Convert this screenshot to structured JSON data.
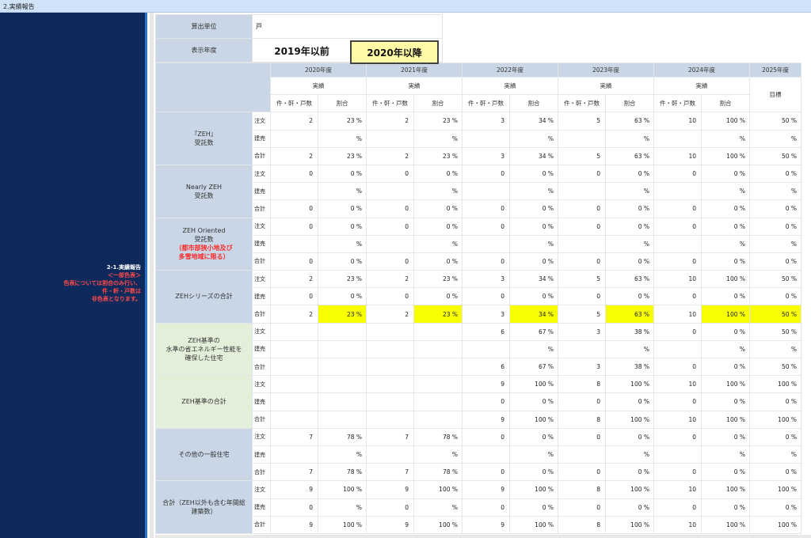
{
  "header": {
    "title": "2.実績報告"
  },
  "sidebar": {
    "title": "2-1.実績報告",
    "note1": "＜一部色表＞",
    "note2": "色表については割合のみ行い、",
    "note3": "件・軒・戸数は",
    "note4": "非色表となります。"
  },
  "settings": {
    "unit_label": "算出単位",
    "unit_value": "戸",
    "year_label": "表示年度",
    "year_before": "2019年以前",
    "year_after": "2020年以降"
  },
  "table": {
    "years": [
      "2020年度",
      "2021年度",
      "2022年度",
      "2023年度",
      "2024年度",
      "2025年度"
    ],
    "jisseki": "実績",
    "count_label": "件・軒・戸数",
    "ratio_label": "割合",
    "target_label": "目標",
    "row_types": [
      "注文",
      "建売",
      "合計"
    ],
    "sections": [
      {
        "name": "『ZEH』\n受託数",
        "rows": [
          [
            "2",
            "23 %",
            "2",
            "23 %",
            "3",
            "34 %",
            "5",
            "63 %",
            "10",
            "100 %",
            "50 %"
          ],
          [
            "",
            "%",
            "",
            "%",
            "",
            "%",
            "",
            "%",
            "",
            "%",
            "%"
          ],
          [
            "2",
            "23 %",
            "2",
            "23 %",
            "3",
            "34 %",
            "5",
            "63 %",
            "10",
            "100 %",
            "50 %"
          ]
        ]
      },
      {
        "name": "Nearly ZEH\n受託数",
        "rows": [
          [
            "0",
            "0 %",
            "0",
            "0 %",
            "0",
            "0 %",
            "0",
            "0 %",
            "0",
            "0 %",
            "0 %"
          ],
          [
            "",
            "%",
            "",
            "%",
            "",
            "%",
            "",
            "%",
            "",
            "%",
            "%"
          ],
          [
            "0",
            "0 %",
            "0",
            "0 %",
            "0",
            "0 %",
            "0",
            "0 %",
            "0",
            "0 %",
            "0 %"
          ]
        ]
      },
      {
        "name": "ZEH Oriented\n受託数",
        "note": "（都市部狭小地及び\n多雪地域に限る）",
        "rows": [
          [
            "0",
            "0 %",
            "0",
            "0 %",
            "0",
            "0 %",
            "0",
            "0 %",
            "0",
            "0 %",
            "0 %"
          ],
          [
            "",
            "%",
            "",
            "%",
            "",
            "%",
            "",
            "%",
            "",
            "%",
            "%"
          ],
          [
            "0",
            "0 %",
            "0",
            "0 %",
            "0",
            "0 %",
            "0",
            "0 %",
            "0",
            "0 %",
            "0 %"
          ]
        ]
      },
      {
        "name": "ZEHシリーズの合計",
        "rows": [
          [
            "2",
            "23 %",
            "2",
            "23 %",
            "3",
            "34 %",
            "5",
            "63 %",
            "10",
            "100 %",
            "50 %"
          ],
          [
            "0",
            "0 %",
            "0",
            "0 %",
            "0",
            "0 %",
            "0",
            "0 %",
            "0",
            "0 %",
            "0 %"
          ],
          [
            "2",
            "23 %",
            "2",
            "23 %",
            "3",
            "34 %",
            "5",
            "63 %",
            "10",
            "100 %",
            "50 %"
          ]
        ]
      },
      {
        "name": "ZEH基準の\n水準の省エネルギー性能を\n確保した住宅",
        "green": true,
        "rows": [
          [
            "",
            "",
            "",
            "",
            "6",
            "67 %",
            "3",
            "38 %",
            "0",
            "0 %",
            "50 %"
          ],
          [
            "",
            "",
            "",
            "",
            "",
            "%",
            "",
            "%",
            "",
            "%",
            "%"
          ],
          [
            "",
            "",
            "",
            "",
            "6",
            "67 %",
            "3",
            "38 %",
            "0",
            "0 %",
            "50 %"
          ]
        ]
      },
      {
        "name": "ZEH基準の合計",
        "green": true,
        "rows": [
          [
            "",
            "",
            "",
            "",
            "9",
            "100 %",
            "8",
            "100 %",
            "10",
            "100 %",
            "100 %"
          ],
          [
            "",
            "",
            "",
            "",
            "0",
            "0 %",
            "0",
            "0 %",
            "0",
            "0 %",
            "0 %"
          ],
          [
            "",
            "",
            "",
            "",
            "9",
            "100 %",
            "8",
            "100 %",
            "10",
            "100 %",
            "100 %"
          ]
        ]
      },
      {
        "name": "その他の一般住宅",
        "rows": [
          [
            "7",
            "78 %",
            "7",
            "78 %",
            "0",
            "0 %",
            "0",
            "0 %",
            "0",
            "0 %",
            "0 %"
          ],
          [
            "",
            "%",
            "",
            "%",
            "",
            "%",
            "",
            "%",
            "",
            "%",
            "%"
          ],
          [
            "7",
            "78 %",
            "7",
            "78 %",
            "0",
            "0 %",
            "0",
            "0 %",
            "0",
            "0 %",
            "0 %"
          ]
        ]
      },
      {
        "name": "合計（ZEH以外も含む年間総\n建築数）",
        "rows": [
          [
            "9",
            "100 %",
            "9",
            "100 %",
            "9",
            "100 %",
            "8",
            "100 %",
            "10",
            "100 %",
            "100 %"
          ],
          [
            "0",
            "%",
            "0",
            "%",
            "0",
            "0 %",
            "0",
            "0 %",
            "0",
            "0 %",
            "0 %"
          ],
          [
            "9",
            "100 %",
            "9",
            "100 %",
            "9",
            "100 %",
            "8",
            "100 %",
            "10",
            "100 %",
            "100 %"
          ]
        ]
      }
    ],
    "highlight_color": "#f8ff00"
  }
}
